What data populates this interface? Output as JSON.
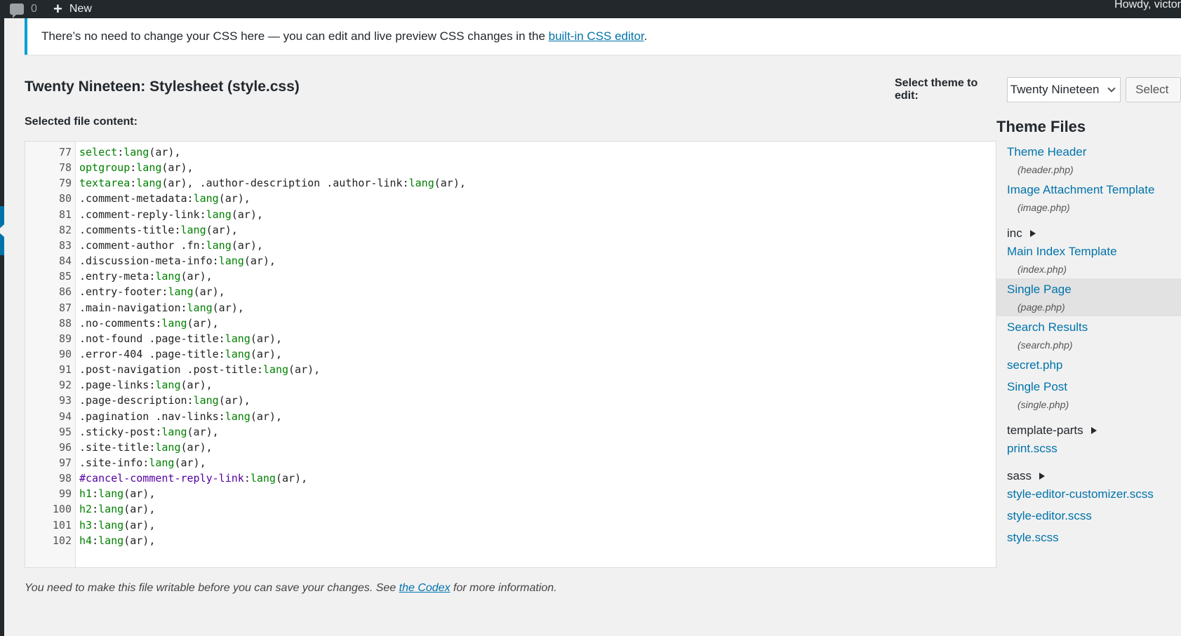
{
  "adminbar": {
    "comments_count": "0",
    "new_label": "New",
    "account_label": "Howdy, victor",
    "comments_icon": "comment-bubble-icon",
    "plus_icon": "plus-icon"
  },
  "notice": {
    "text_before": "There’s no need to change your CSS here — you can edit and live preview CSS changes in the ",
    "link_text": "built-in CSS editor",
    "text_after": ".",
    "accent": "#00a0d2"
  },
  "page": {
    "file_title": "Twenty Nineteen: Stylesheet (style.css)",
    "select_theme_label": "Select theme to edit:",
    "selected_theme": "Twenty Nineteen",
    "select_button": "Select",
    "selected_file_label": "Selected file content:"
  },
  "editor": {
    "lines": [
      {
        "n": "77",
        "tokens": [
          {
            "t": "select",
            "c": "green"
          },
          {
            "t": ":",
            "c": "dark"
          },
          {
            "t": "lang",
            "c": "green"
          },
          {
            "t": "(ar),",
            "c": "dark"
          }
        ]
      },
      {
        "n": "78",
        "tokens": [
          {
            "t": "optgroup",
            "c": "green"
          },
          {
            "t": ":",
            "c": "dark"
          },
          {
            "t": "lang",
            "c": "green"
          },
          {
            "t": "(ar),",
            "c": "dark"
          }
        ]
      },
      {
        "n": "79",
        "tokens": [
          {
            "t": "textarea",
            "c": "green"
          },
          {
            "t": ":",
            "c": "dark"
          },
          {
            "t": "lang",
            "c": "green"
          },
          {
            "t": "(ar), .author-description .author-link:",
            "c": "dark"
          },
          {
            "t": "lang",
            "c": "green"
          },
          {
            "t": "(ar),",
            "c": "dark"
          }
        ]
      },
      {
        "n": "80",
        "tokens": [
          {
            "t": ".comment-metadata:",
            "c": "dark"
          },
          {
            "t": "lang",
            "c": "green"
          },
          {
            "t": "(ar),",
            "c": "dark"
          }
        ]
      },
      {
        "n": "81",
        "tokens": [
          {
            "t": ".comment-reply-link:",
            "c": "dark"
          },
          {
            "t": "lang",
            "c": "green"
          },
          {
            "t": "(ar),",
            "c": "dark"
          }
        ]
      },
      {
        "n": "82",
        "tokens": [
          {
            "t": ".comments-title:",
            "c": "dark"
          },
          {
            "t": "lang",
            "c": "green"
          },
          {
            "t": "(ar),",
            "c": "dark"
          }
        ]
      },
      {
        "n": "83",
        "tokens": [
          {
            "t": ".comment-author .fn:",
            "c": "dark"
          },
          {
            "t": "lang",
            "c": "green"
          },
          {
            "t": "(ar),",
            "c": "dark"
          }
        ]
      },
      {
        "n": "84",
        "tokens": [
          {
            "t": ".discussion-meta-info:",
            "c": "dark"
          },
          {
            "t": "lang",
            "c": "green"
          },
          {
            "t": "(ar),",
            "c": "dark"
          }
        ]
      },
      {
        "n": "85",
        "tokens": [
          {
            "t": ".entry-meta:",
            "c": "dark"
          },
          {
            "t": "lang",
            "c": "green"
          },
          {
            "t": "(ar),",
            "c": "dark"
          }
        ]
      },
      {
        "n": "86",
        "tokens": [
          {
            "t": ".entry-footer:",
            "c": "dark"
          },
          {
            "t": "lang",
            "c": "green"
          },
          {
            "t": "(ar),",
            "c": "dark"
          }
        ]
      },
      {
        "n": "87",
        "tokens": [
          {
            "t": ".main-navigation:",
            "c": "dark"
          },
          {
            "t": "lang",
            "c": "green"
          },
          {
            "t": "(ar),",
            "c": "dark"
          }
        ]
      },
      {
        "n": "88",
        "tokens": [
          {
            "t": ".no-comments:",
            "c": "dark"
          },
          {
            "t": "lang",
            "c": "green"
          },
          {
            "t": "(ar),",
            "c": "dark"
          }
        ]
      },
      {
        "n": "89",
        "tokens": [
          {
            "t": ".not-found .page-title:",
            "c": "dark"
          },
          {
            "t": "lang",
            "c": "green"
          },
          {
            "t": "(ar),",
            "c": "dark"
          }
        ]
      },
      {
        "n": "90",
        "tokens": [
          {
            "t": ".error-404 .page-title:",
            "c": "dark"
          },
          {
            "t": "lang",
            "c": "green"
          },
          {
            "t": "(ar),",
            "c": "dark"
          }
        ]
      },
      {
        "n": "91",
        "tokens": [
          {
            "t": ".post-navigation .post-title:",
            "c": "dark"
          },
          {
            "t": "lang",
            "c": "green"
          },
          {
            "t": "(ar),",
            "c": "dark"
          }
        ]
      },
      {
        "n": "92",
        "tokens": [
          {
            "t": ".page-links:",
            "c": "dark"
          },
          {
            "t": "lang",
            "c": "green"
          },
          {
            "t": "(ar),",
            "c": "dark"
          }
        ]
      },
      {
        "n": "93",
        "tokens": [
          {
            "t": ".page-description:",
            "c": "dark"
          },
          {
            "t": "lang",
            "c": "green"
          },
          {
            "t": "(ar),",
            "c": "dark"
          }
        ]
      },
      {
        "n": "94",
        "tokens": [
          {
            "t": ".pagination .nav-links:",
            "c": "dark"
          },
          {
            "t": "lang",
            "c": "green"
          },
          {
            "t": "(ar),",
            "c": "dark"
          }
        ]
      },
      {
        "n": "95",
        "tokens": [
          {
            "t": ".sticky-post:",
            "c": "dark"
          },
          {
            "t": "lang",
            "c": "green"
          },
          {
            "t": "(ar),",
            "c": "dark"
          }
        ]
      },
      {
        "n": "96",
        "tokens": [
          {
            "t": ".site-title:",
            "c": "dark"
          },
          {
            "t": "lang",
            "c": "green"
          },
          {
            "t": "(ar),",
            "c": "dark"
          }
        ]
      },
      {
        "n": "97",
        "tokens": [
          {
            "t": ".site-info:",
            "c": "dark"
          },
          {
            "t": "lang",
            "c": "green"
          },
          {
            "t": "(ar),",
            "c": "dark"
          }
        ]
      },
      {
        "n": "98",
        "tokens": [
          {
            "t": "#cancel-comment-reply-link",
            "c": "purple"
          },
          {
            "t": ":",
            "c": "dark"
          },
          {
            "t": "lang",
            "c": "green"
          },
          {
            "t": "(ar),",
            "c": "dark"
          }
        ]
      },
      {
        "n": "99",
        "tokens": [
          {
            "t": "h1",
            "c": "green"
          },
          {
            "t": ":",
            "c": "dark"
          },
          {
            "t": "lang",
            "c": "green"
          },
          {
            "t": "(ar),",
            "c": "dark"
          }
        ]
      },
      {
        "n": "100",
        "tokens": [
          {
            "t": "h2",
            "c": "green"
          },
          {
            "t": ":",
            "c": "dark"
          },
          {
            "t": "lang",
            "c": "green"
          },
          {
            "t": "(ar),",
            "c": "dark"
          }
        ]
      },
      {
        "n": "101",
        "tokens": [
          {
            "t": "h3",
            "c": "green"
          },
          {
            "t": ":",
            "c": "dark"
          },
          {
            "t": "lang",
            "c": "green"
          },
          {
            "t": "(ar),",
            "c": "dark"
          }
        ]
      },
      {
        "n": "102",
        "tokens": [
          {
            "t": "h4",
            "c": "green"
          },
          {
            "t": ":",
            "c": "dark"
          },
          {
            "t": "lang",
            "c": "green"
          },
          {
            "t": "(ar),",
            "c": "dark"
          }
        ]
      }
    ]
  },
  "theme_files": {
    "title": "Theme Files",
    "items": [
      {
        "kind": "file",
        "name": "Theme Header",
        "file": "(header.php)"
      },
      {
        "kind": "file",
        "name": "Image Attachment Template",
        "file": "(image.php)"
      },
      {
        "kind": "folder",
        "name": "inc"
      },
      {
        "kind": "file",
        "name": "Main Index Template",
        "file": "(index.php)"
      },
      {
        "kind": "file",
        "name": "Single Page",
        "file": "(page.php)",
        "active": true
      },
      {
        "kind": "file",
        "name": "Search Results",
        "file": "(search.php)"
      },
      {
        "kind": "file",
        "name": "secret.php"
      },
      {
        "kind": "file",
        "name": "Single Post",
        "file": "(single.php)"
      },
      {
        "kind": "folder",
        "name": "template-parts"
      },
      {
        "kind": "file",
        "name": "print.scss"
      },
      {
        "kind": "folder",
        "name": "sass"
      },
      {
        "kind": "file",
        "name": "style-editor-customizer.scss"
      },
      {
        "kind": "file",
        "name": "style-editor.scss"
      },
      {
        "kind": "file",
        "name": "style.scss"
      }
    ]
  },
  "footer": {
    "text_before": "You need to make this file writable before you can save your changes. See ",
    "link_text": "the Codex",
    "text_after": " for more information."
  },
  "colors": {
    "link": "#0073aa",
    "code_green": "#008000",
    "code_purple": "#5400a0",
    "adminbar": "#23282d"
  }
}
